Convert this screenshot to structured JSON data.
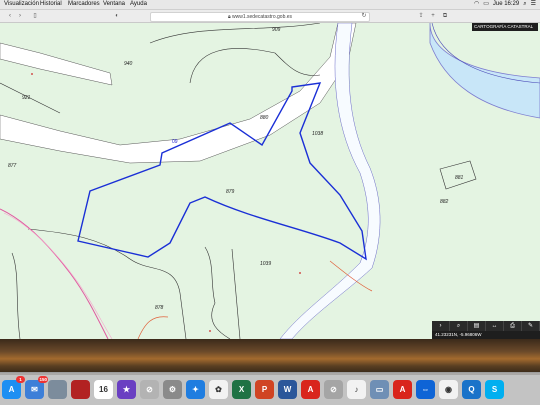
{
  "menubar": {
    "items": [
      "Visualización",
      "Historial",
      "Marcadores",
      "Ventana",
      "Ayuda"
    ],
    "clock": "Jue 16:29"
  },
  "browser": {
    "url": "www1.sedecatastro.gob.es"
  },
  "map": {
    "tag": "CARTOGRAFÍA CATASTRAL",
    "coordinates": "41.23231N, -5.96806W",
    "parcels": [
      "909",
      "940",
      "921",
      "877",
      "880",
      "1038",
      "879",
      "881",
      "882",
      "1039",
      "878"
    ],
    "controls": [
      "play-icon",
      "zoom-icon",
      "layers-icon",
      "expand-icon",
      "print-icon",
      "measure-icon"
    ]
  },
  "dock": {
    "apps": [
      {
        "name": "App Store",
        "color": "#1d8ff2",
        "glyph": "A",
        "badge": "1"
      },
      {
        "name": "Mail",
        "color": "#3d7fd8",
        "glyph": "✉",
        "badge": "150"
      },
      {
        "name": "Preview",
        "color": "#7c8c9c",
        "glyph": "",
        "badge": ""
      },
      {
        "name": "Photo Booth",
        "color": "#b22222",
        "glyph": "",
        "badge": ""
      },
      {
        "name": "Calendar",
        "color": "#ffffff",
        "glyph": "16",
        "badge": ""
      },
      {
        "name": "iMovie",
        "color": "#6a3fc2",
        "glyph": "★",
        "badge": ""
      },
      {
        "name": "Safari Alt",
        "color": "#b3b3b3",
        "glyph": "⊘",
        "badge": ""
      },
      {
        "name": "System Preferences",
        "color": "#8a8a8a",
        "glyph": "⚙",
        "badge": ""
      },
      {
        "name": "Safari",
        "color": "#1f7de0",
        "glyph": "✦",
        "badge": ""
      },
      {
        "name": "Photos",
        "color": "#f2f2f2",
        "glyph": "✿",
        "badge": ""
      },
      {
        "name": "Excel",
        "color": "#1f7244",
        "glyph": "X",
        "badge": ""
      },
      {
        "name": "PowerPoint",
        "color": "#d04423",
        "glyph": "P",
        "badge": ""
      },
      {
        "name": "Word",
        "color": "#2b579a",
        "glyph": "W",
        "badge": ""
      },
      {
        "name": "Acrobat",
        "color": "#d9251c",
        "glyph": "A",
        "badge": ""
      },
      {
        "name": "Utility",
        "color": "#a5a5a5",
        "glyph": "⊘",
        "badge": ""
      },
      {
        "name": "Music",
        "color": "#f2f2f2",
        "glyph": "♪",
        "badge": ""
      },
      {
        "name": "Image Capture",
        "color": "#6f8fb5",
        "glyph": "▭",
        "badge": ""
      },
      {
        "name": "Acrobat Reader",
        "color": "#d9251c",
        "glyph": "A",
        "badge": ""
      },
      {
        "name": "TeamViewer",
        "color": "#0e64d6",
        "glyph": "⇔",
        "badge": ""
      },
      {
        "name": "Chrome",
        "color": "#f2f2f2",
        "glyph": "◉",
        "badge": ""
      },
      {
        "name": "QuickTime",
        "color": "#1a73c9",
        "glyph": "Q",
        "badge": ""
      },
      {
        "name": "Skype",
        "color": "#00aff0",
        "glyph": "S",
        "badge": ""
      }
    ]
  }
}
